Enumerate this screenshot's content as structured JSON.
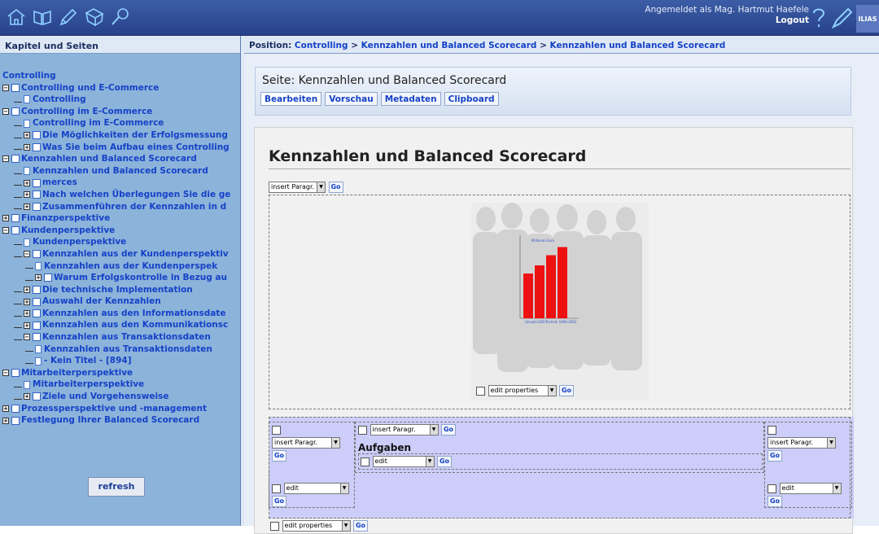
{
  "header": {
    "user_label": "Angemeldet als Mag. Hartmut Haefele",
    "logout": "Logout",
    "logo": "ILIAS",
    "icons": [
      "home-icon",
      "book-icon",
      "pencil-icon",
      "forum-icon",
      "search-icon"
    ]
  },
  "left": {
    "title": "Kapitel und Seiten",
    "root": "Controlling",
    "tree": [
      {
        "label": "Controlling und E-Commerce",
        "type": "chapter",
        "depth": 0,
        "toggle": "minus"
      },
      {
        "label": "Controlling",
        "type": "page",
        "depth": 1
      },
      {
        "label": "Controlling im E-Commerce",
        "type": "chapter",
        "depth": 0,
        "toggle": "minus"
      },
      {
        "label": "Controlling im E-Commerce",
        "type": "page",
        "depth": 1
      },
      {
        "label": "Die Möglichkeiten der Erfolgsmessung",
        "type": "chapter",
        "depth": 1,
        "toggle": "plus"
      },
      {
        "label": "Was Sie beim Aufbau eines Controlling",
        "type": "chapter",
        "depth": 1,
        "toggle": "plus"
      },
      {
        "label": "Kennzahlen und Balanced Scorecard",
        "type": "chapter",
        "depth": 0,
        "toggle": "minus"
      },
      {
        "label": "Kennzahlen und Balanced Scorecard",
        "type": "page",
        "depth": 1
      },
      {
        "label": "merces",
        "type": "chapter",
        "depth": 1,
        "toggle": "plus"
      },
      {
        "label": "Nach welchen Überlegungen Sie die ge",
        "type": "chapter",
        "depth": 1,
        "toggle": "plus"
      },
      {
        "label": "Zusammenführen der Kennzahlen in d",
        "type": "chapter",
        "depth": 1,
        "toggle": "plus"
      },
      {
        "label": "Finanzperspektive",
        "type": "chapter",
        "depth": 0,
        "toggle": "plus"
      },
      {
        "label": "Kundenperspektive",
        "type": "chapter",
        "depth": 0,
        "toggle": "minus"
      },
      {
        "label": "Kundenperspektive",
        "type": "page",
        "depth": 1
      },
      {
        "label": "Kennzahlen aus der Kundenperspektiv",
        "type": "chapter",
        "depth": 1,
        "toggle": "minus"
      },
      {
        "label": "Kennzahlen aus der Kundenperspek",
        "type": "page",
        "depth": 2
      },
      {
        "label": "Warum Erfolgskontrolle in Bezug au",
        "type": "chapter",
        "depth": 2,
        "toggle": "plus"
      },
      {
        "label": "Die technische Implementation",
        "type": "chapter",
        "depth": 1,
        "toggle": "plus"
      },
      {
        "label": "Auswahl der Kennzahlen",
        "type": "chapter",
        "depth": 1,
        "toggle": "plus"
      },
      {
        "label": "Kennzahlen aus den Informationsdate",
        "type": "chapter",
        "depth": 1,
        "toggle": "plus"
      },
      {
        "label": "Kennzahlen aus den Kommunikationsc",
        "type": "chapter",
        "depth": 1,
        "toggle": "plus"
      },
      {
        "label": "Kennzahlen aus Transaktionsdaten",
        "type": "chapter",
        "depth": 1,
        "toggle": "minus"
      },
      {
        "label": "Kennzahlen aus Transaktionsdaten",
        "type": "page",
        "depth": 2
      },
      {
        "label": "- Kein Titel - [894]",
        "type": "page",
        "depth": 2
      },
      {
        "label": "Mitarbeiterperspektive",
        "type": "chapter",
        "depth": 0,
        "toggle": "minus"
      },
      {
        "label": "Mitarbeiterperspektive",
        "type": "page",
        "depth": 1
      },
      {
        "label": "Ziele und Vorgehensweise",
        "type": "chapter",
        "depth": 1,
        "toggle": "plus"
      },
      {
        "label": "Prozessperspektive und -management",
        "type": "chapter",
        "depth": 0,
        "toggle": "plus"
      },
      {
        "label": "Festlegung Ihrer Balanced Scorecard",
        "type": "chapter",
        "depth": 0,
        "toggle": "plus"
      }
    ],
    "refresh": "refresh"
  },
  "position": {
    "label": "Position:",
    "crumbs": [
      "Controlling",
      "Kennzahlen und Balanced Scorecard",
      "Kennzahlen und Balanced Scorecard"
    ],
    "sep": ">"
  },
  "page": {
    "title": "Seite: Kennzahlen und Balanced Scorecard",
    "tabs": [
      "Bearbeiten",
      "Vorschau",
      "Metadaten",
      "Clipboard"
    ],
    "heading": "Kennzahlen und Balanced Scorecard"
  },
  "editor": {
    "insert_paragr": "insert Paragr.",
    "go": "Go",
    "edit_properties": "edit properties",
    "edit": "edit",
    "aufgaben": "Aufgaben"
  },
  "figure": {
    "caption": "Umsatz EDV-Technik 1999-2002",
    "legend": "Millionen Euro",
    "bar_color": "#ee1111",
    "bars": [
      11,
      13,
      15.5,
      17.5
    ]
  }
}
